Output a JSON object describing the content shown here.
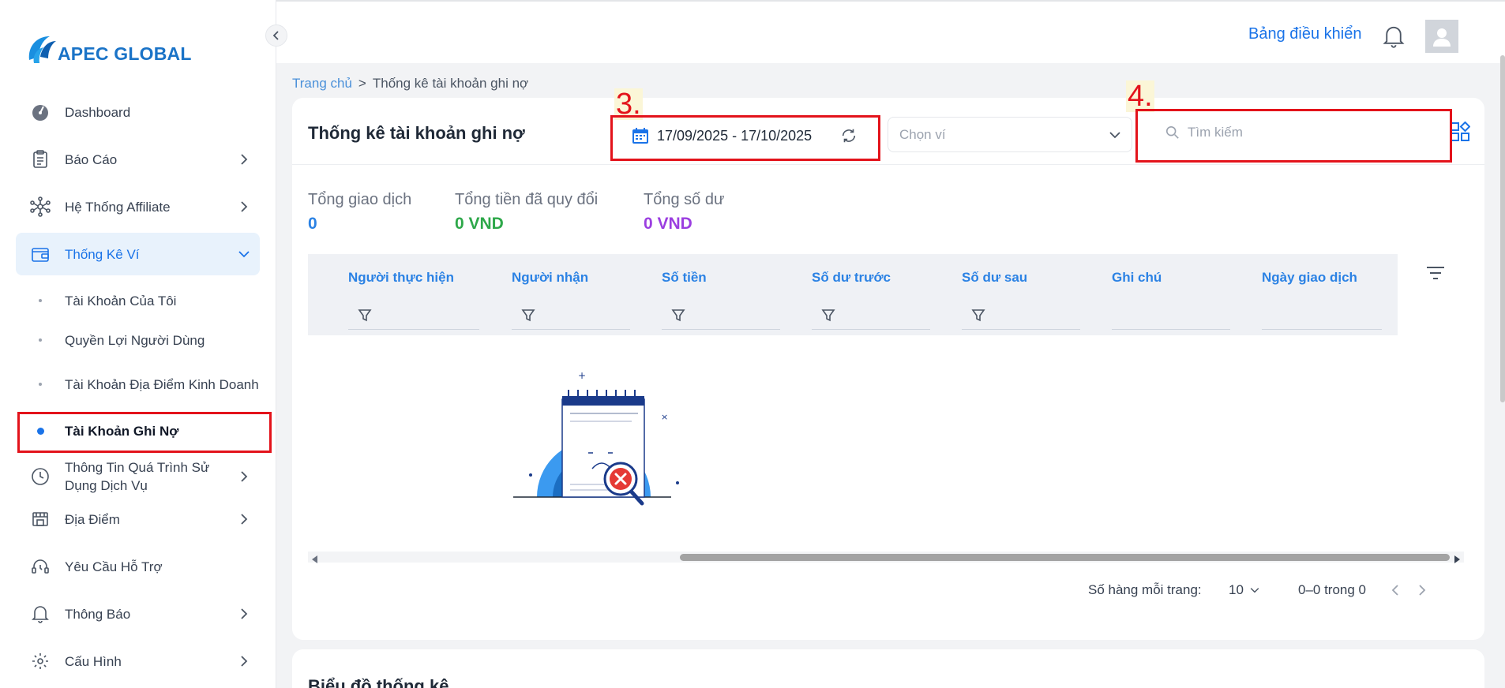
{
  "brand": {
    "name": "APEC GLOBAL"
  },
  "header": {
    "dashboard_link": "Bảng điều khiển"
  },
  "sidebar": {
    "items": [
      {
        "label": "Dashboard",
        "icon": "dashboard-gauge-icon"
      },
      {
        "label": "Báo Cáo",
        "icon": "report-clipboard-icon"
      },
      {
        "label": "Hệ Thống Affiliate",
        "icon": "affiliate-network-icon"
      },
      {
        "label": "Thống Kê Ví",
        "icon": "wallet-icon",
        "expanded": true
      },
      {
        "label": "Thông Tin Quá Trình Sử Dụng Dịch Vụ",
        "icon": "clock-history-icon"
      },
      {
        "label": "Địa Điểm",
        "icon": "location-store-icon"
      },
      {
        "label": "Yêu Cầu Hỗ Trợ",
        "icon": "support-headset-icon"
      },
      {
        "label": "Thông Báo",
        "icon": "bell-icon"
      },
      {
        "label": "Cấu Hình",
        "icon": "gear-icon"
      }
    ],
    "subitems": [
      {
        "label": "Tài Khoản Của Tôi"
      },
      {
        "label": "Quyền Lợi Người Dùng"
      },
      {
        "label": "Tài Khoản Địa Điểm Kinh Doanh"
      },
      {
        "label": "Tài Khoản Ghi Nợ",
        "active": true
      }
    ]
  },
  "breadcrumb": {
    "home": "Trang chủ",
    "separator": ">",
    "current": "Thống kê tài khoản ghi nợ"
  },
  "card": {
    "title": "Thống kê tài khoản ghi nợ",
    "date_range": "17/09/2025 - 17/10/2025",
    "wallet_placeholder": "Chọn ví",
    "search_placeholder": "Tìm kiếm",
    "annotations": [
      "3.",
      "4."
    ]
  },
  "stats": [
    {
      "label": "Tổng giao dịch",
      "value": "0",
      "color": "#2b82e4"
    },
    {
      "label": "Tổng tiền đã quy đổi",
      "value": "0 VND",
      "color": "#2ea84a"
    },
    {
      "label": "Tổng số dư",
      "value": "0 VND",
      "color": "#9b3ee0"
    }
  ],
  "table": {
    "columns": [
      "Người thực hiện",
      "Người nhận",
      "Số tiền",
      "Số dư trước",
      "Số dư sau",
      "Ghi chú",
      "Ngày giao dịch"
    ]
  },
  "pagination": {
    "rows_label": "Số hàng mỗi trang:",
    "rows_value": "10",
    "range": "0–0 trong 0"
  },
  "chart_section": {
    "title": "Biểu đồ thống kê"
  },
  "colors": {
    "accent": "#1a73e8",
    "highlight_box": "#e3131b",
    "annotation_bg": "#fbf6d7"
  }
}
